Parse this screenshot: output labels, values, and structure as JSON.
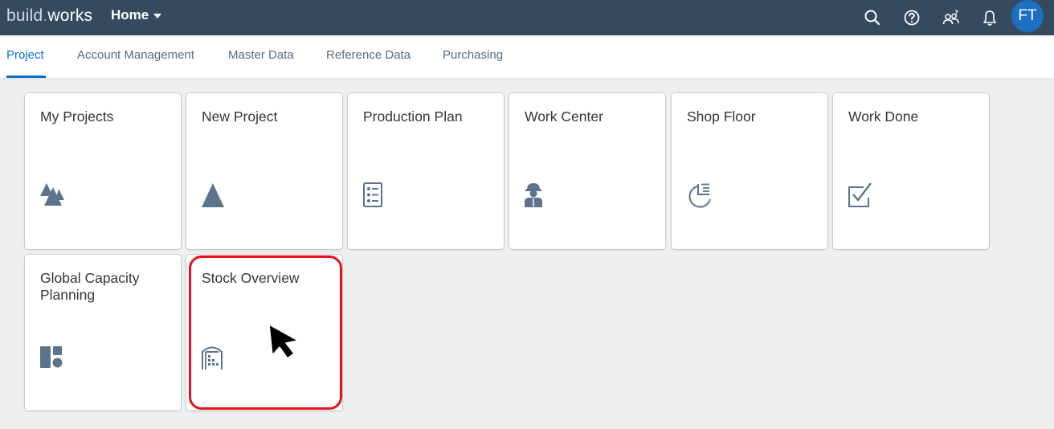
{
  "shell": {
    "brand_part1": "build",
    "brand_dot": ".",
    "brand_part2": "works",
    "menu_title": "Home",
    "avatar_initials": "FT",
    "icons": [
      "search-icon",
      "help-icon",
      "user-group-icon",
      "notification-bell-icon"
    ]
  },
  "tabs": [
    {
      "label": "Project",
      "active": true
    },
    {
      "label": "Account Management",
      "active": false
    },
    {
      "label": "Master Data",
      "active": false
    },
    {
      "label": "Reference Data",
      "active": false
    },
    {
      "label": "Purchasing",
      "active": false
    }
  ],
  "tiles": [
    {
      "title": "My Projects",
      "icon": "projects-icon"
    },
    {
      "title": "New Project",
      "icon": "triangle-icon"
    },
    {
      "title": "Production Plan",
      "icon": "checklist-icon"
    },
    {
      "title": "Work Center",
      "icon": "worker-icon"
    },
    {
      "title": "Shop Floor",
      "icon": "timeline-icon"
    },
    {
      "title": "Work Done",
      "icon": "checkbox-icon"
    },
    {
      "title": "Global Capacity Planning",
      "icon": "dashboard-blocks-icon"
    },
    {
      "title": "Stock Overview",
      "icon": "warehouse-icon"
    }
  ],
  "colors": {
    "shell_bg": "#354a5f",
    "accent": "#0a6ed1",
    "icon": "#5b738b",
    "highlight": "#e8101d"
  }
}
